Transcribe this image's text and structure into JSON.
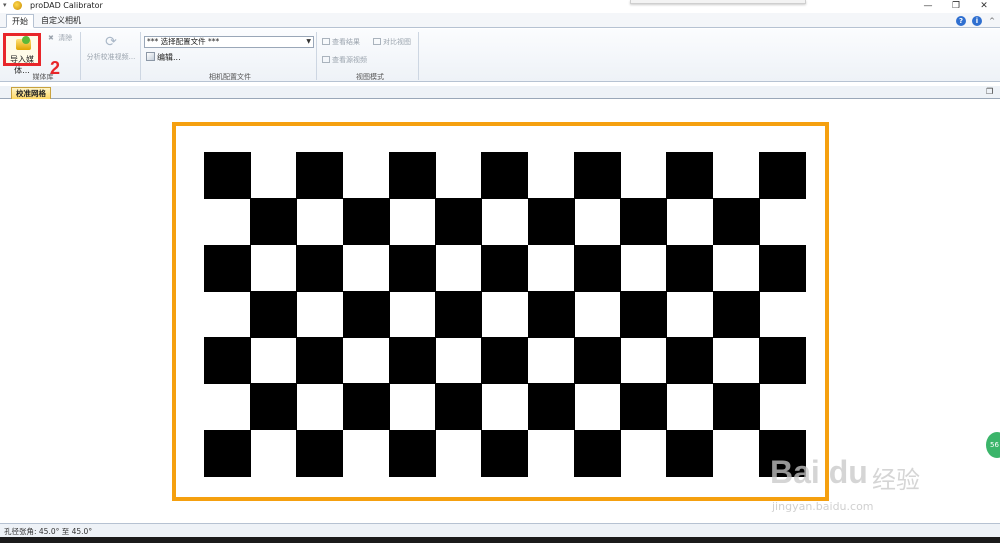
{
  "window": {
    "title": "proDAD Calibrator",
    "min": "—",
    "max": "❐",
    "close": "✕"
  },
  "tabs": {
    "start": "开始",
    "custom_camera": "自定义相机"
  },
  "header_icons": {
    "help": "?",
    "info": "i",
    "collapse": "^"
  },
  "ribbon": {
    "media_group": {
      "import_label": "导入媒体...",
      "clear_label": "清除",
      "group_label": "媒体库"
    },
    "analyze": {
      "label": "分析校准视频..."
    },
    "camera_profile_group": {
      "select_value": "*** 选择配置文件 ***",
      "edit_label": "编辑...",
      "group_label": "相机配置文件"
    },
    "view_mode_group": {
      "view_result": "查看结果",
      "compare_view": "对比视图",
      "view_source": "查看源视频",
      "group_label": "视图模式"
    }
  },
  "annotation": {
    "step_number": "2",
    "color": "#e8262a"
  },
  "doc_tab": {
    "label": "校准网格"
  },
  "canvas": {
    "frame_color": "#f5a00f",
    "checker_columns": 13,
    "checker_rows": 7
  },
  "side_widget": {
    "label": "56"
  },
  "watermark": {
    "logo": "Bai du",
    "cn": "经验",
    "url": "jingyan.baidu.com"
  },
  "statusbar": {
    "text": "孔径张角: 45.0° 至 45.0°"
  }
}
